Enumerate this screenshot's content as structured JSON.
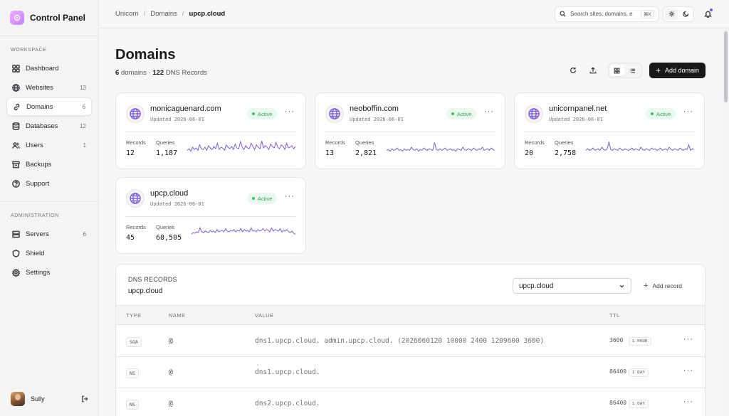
{
  "app": {
    "title": "Control Panel"
  },
  "sidebar": {
    "sections": [
      {
        "label": "WORKSPACE",
        "items": [
          {
            "label": "Dashboard",
            "count": "",
            "icon": "grid-icon"
          },
          {
            "label": "Websites",
            "count": "13",
            "icon": "globe-icon"
          },
          {
            "label": "Domains",
            "count": "6",
            "icon": "link-icon",
            "active": true
          },
          {
            "label": "Databases",
            "count": "12",
            "icon": "database-icon"
          },
          {
            "label": "Users",
            "count": "1",
            "icon": "users-icon"
          },
          {
            "label": "Backups",
            "count": "",
            "icon": "archive-icon"
          },
          {
            "label": "Support",
            "count": "",
            "icon": "help-icon"
          }
        ]
      },
      {
        "label": "ADMINISTRATION",
        "items": [
          {
            "label": "Servers",
            "count": "6",
            "icon": "server-icon"
          },
          {
            "label": "Shield",
            "count": "",
            "icon": "shield-icon"
          },
          {
            "label": "Settings",
            "count": "",
            "icon": "gear-icon"
          }
        ]
      }
    ],
    "user": {
      "name": "Sully"
    }
  },
  "topbar": {
    "breadcrumb": [
      "Unicorn",
      "Domains",
      "upcp.cloud"
    ],
    "search": {
      "placeholder": "Search sites, domains, e",
      "shortcut": "⌘K"
    }
  },
  "page": {
    "title": "Domains",
    "domains_count": "6",
    "domains_word": "domains",
    "records_count": "122",
    "records_word": "DNS Records",
    "add_button": "Add domain"
  },
  "domains": [
    {
      "name": "monicaguenard.com",
      "updated": "Updated 2026-06-01",
      "status": "Active",
      "records_label": "Records",
      "records": "12",
      "queries_label": "Queries",
      "queries": "1,187",
      "spark": [
        5,
        7,
        4,
        9,
        6,
        8,
        5,
        12,
        7,
        6,
        9,
        5,
        11,
        8,
        6,
        10,
        7,
        14,
        6,
        9,
        8,
        5,
        12,
        9,
        7,
        10,
        6,
        13,
        8,
        7,
        16,
        9,
        6,
        11,
        8,
        7,
        14,
        10,
        6,
        12,
        9,
        7,
        17,
        8,
        11,
        9,
        6,
        13,
        10,
        8,
        15,
        9,
        7,
        12,
        10,
        6,
        14,
        8,
        9,
        11,
        7,
        10
      ]
    },
    {
      "name": "neoboffin.com",
      "updated": "Updated 2026-06-01",
      "status": "Active",
      "records_label": "Records",
      "records": "13",
      "queries_label": "Queries",
      "queries": "2,821",
      "spark": [
        5,
        6,
        4,
        7,
        5,
        6,
        8,
        5,
        6,
        4,
        7,
        5,
        6,
        5,
        9,
        6,
        5,
        7,
        4,
        6,
        5,
        8,
        6,
        5,
        7,
        6,
        5,
        15,
        6,
        5,
        7,
        5,
        6,
        8,
        5,
        6,
        7,
        5,
        6,
        4,
        7,
        6,
        5,
        9,
        6,
        5,
        7,
        6,
        5,
        8,
        6,
        5,
        7,
        6,
        9,
        5,
        6,
        7,
        5,
        8,
        6,
        5
      ]
    },
    {
      "name": "unicornpanel.net",
      "updated": "Updated 2026-06-01",
      "status": "Active",
      "records_label": "Records",
      "records": "20",
      "queries_label": "Queries",
      "queries": "2,758",
      "spark": [
        5,
        7,
        5,
        6,
        8,
        5,
        6,
        7,
        5,
        9,
        6,
        5,
        7,
        16,
        6,
        5,
        7,
        6,
        5,
        8,
        6,
        5,
        7,
        6,
        5,
        6,
        8,
        5,
        7,
        6,
        5,
        9,
        6,
        5,
        7,
        6,
        5,
        8,
        6,
        7,
        5,
        6,
        8,
        5,
        6,
        7,
        5,
        9,
        6,
        5,
        7,
        6,
        5,
        8,
        6,
        5,
        7,
        6,
        12,
        5,
        7,
        6
      ]
    },
    {
      "name": "upcp.cloud",
      "updated": "Updated 2026-06-01",
      "status": "Active",
      "records_label": "Records",
      "records": "45",
      "queries_label": "Queries",
      "queries": "68,505",
      "spark": [
        6,
        8,
        7,
        9,
        8,
        14,
        9,
        8,
        10,
        9,
        8,
        11,
        9,
        10,
        8,
        12,
        9,
        10,
        11,
        9,
        13,
        10,
        9,
        11,
        10,
        12,
        9,
        11,
        10,
        13,
        9,
        12,
        10,
        11,
        9,
        14,
        10,
        11,
        9,
        12,
        10,
        11,
        13,
        10,
        12,
        11,
        9,
        14,
        10,
        12,
        11,
        10,
        13,
        9,
        11,
        10,
        12,
        9,
        8,
        10,
        7,
        6
      ]
    }
  ],
  "dns": {
    "section_label": "DNS RECORDS",
    "domain": "upcp.cloud",
    "select_value": "upcp.cloud",
    "add_record": "Add record",
    "columns": {
      "type": "TYPE",
      "name": "NAME",
      "value": "VALUE",
      "ttl": "TTL"
    },
    "rows": [
      {
        "type": "SOA",
        "name": "@",
        "value": "dns1.upcp.cloud. admin.upcp.cloud. (2026060120 10000 2400 1209600 3600)",
        "ttl": "3600",
        "ttl_label": "1 HOUR"
      },
      {
        "type": "NS",
        "name": "@",
        "value": "dns1.upcp.cloud.",
        "ttl": "86400",
        "ttl_label": "1 DAY"
      },
      {
        "type": "NS",
        "name": "@",
        "value": "dns2.upcp.cloud.",
        "ttl": "86400",
        "ttl_label": "1 DAY"
      }
    ]
  },
  "colors": {
    "accent": "#7c5ed8",
    "active_bg": "#e9f7ec",
    "active_fg": "#3aa65a",
    "primary_button": "#18181b"
  }
}
